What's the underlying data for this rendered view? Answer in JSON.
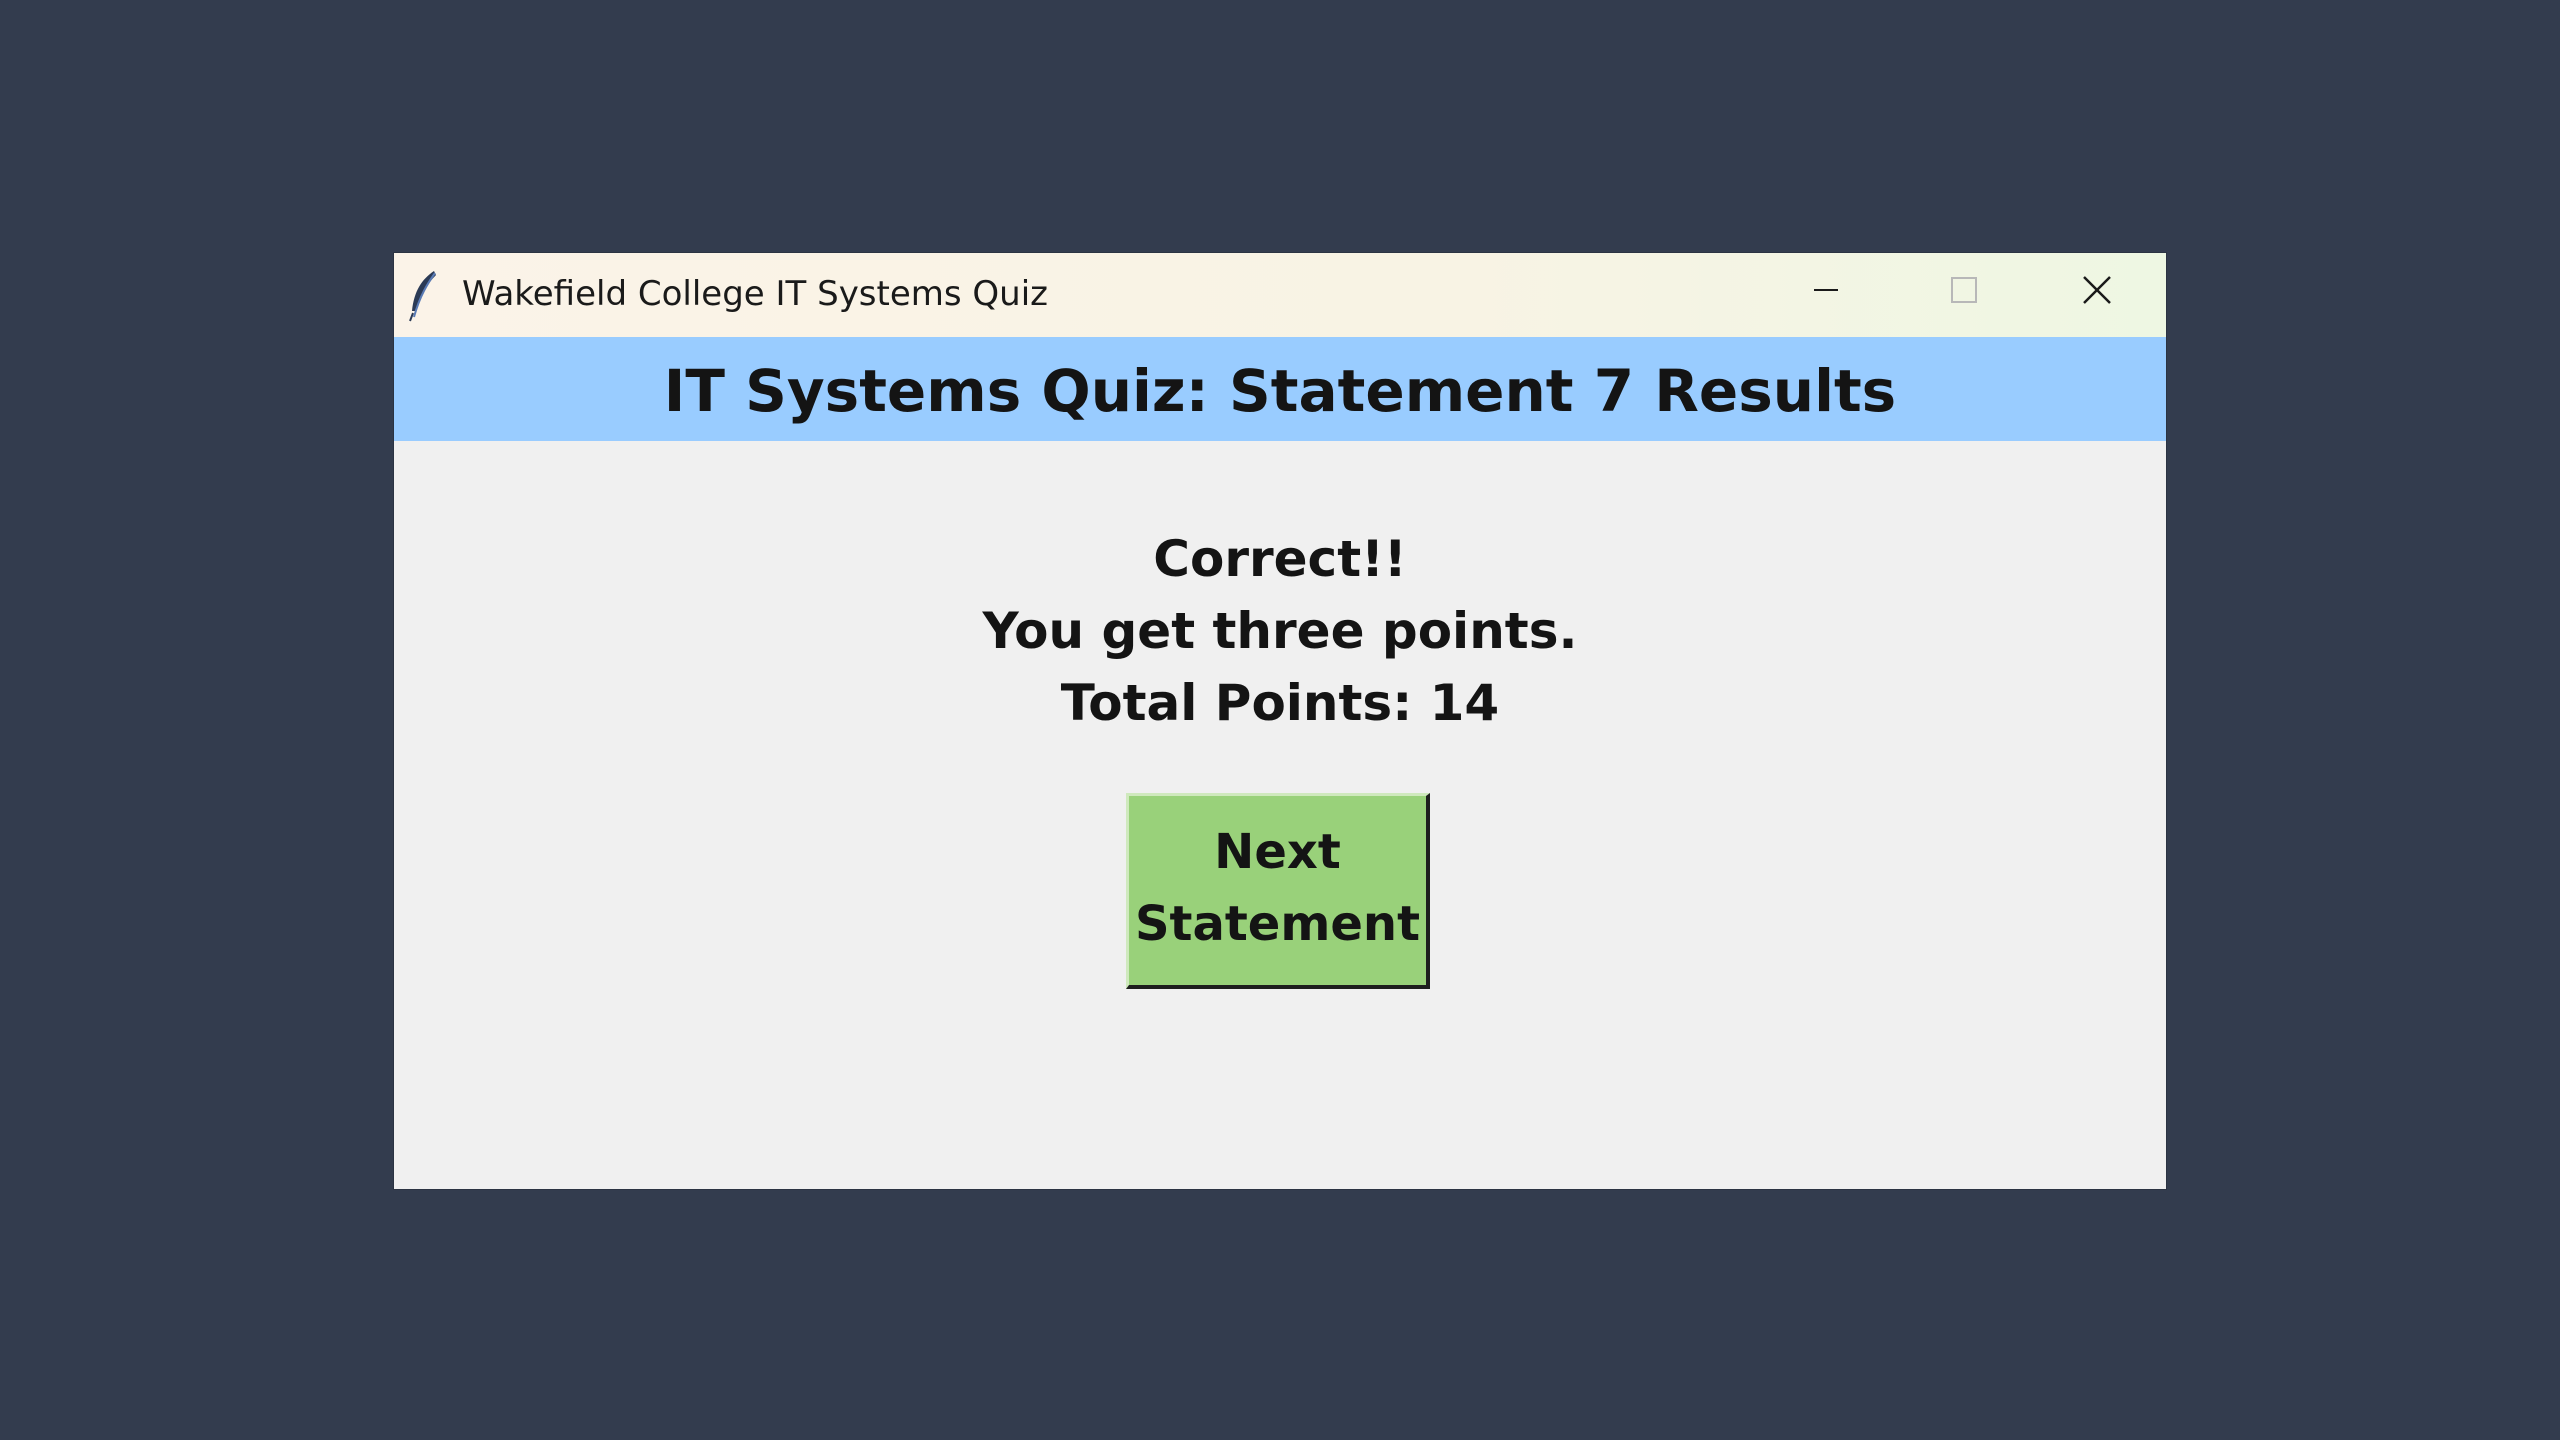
{
  "window": {
    "title": "Wakefield College IT Systems Quiz",
    "icon": "feather-icon",
    "controls": {
      "minimize": "minimize-icon",
      "maximize": "maximize-icon",
      "close": "close-icon"
    }
  },
  "header": {
    "title": "IT Systems Quiz: Statement 7 Results"
  },
  "result": {
    "status": "Correct!!",
    "points_message": "You get three points.",
    "total_points": "Total Points: 14"
  },
  "actions": {
    "next_line1": "Next",
    "next_line2": "Statement"
  },
  "colors": {
    "desktop": "#333c4e",
    "header_bg": "#99ccff",
    "button_bg": "#99d17a",
    "window_bg": "#f0f0f0"
  }
}
